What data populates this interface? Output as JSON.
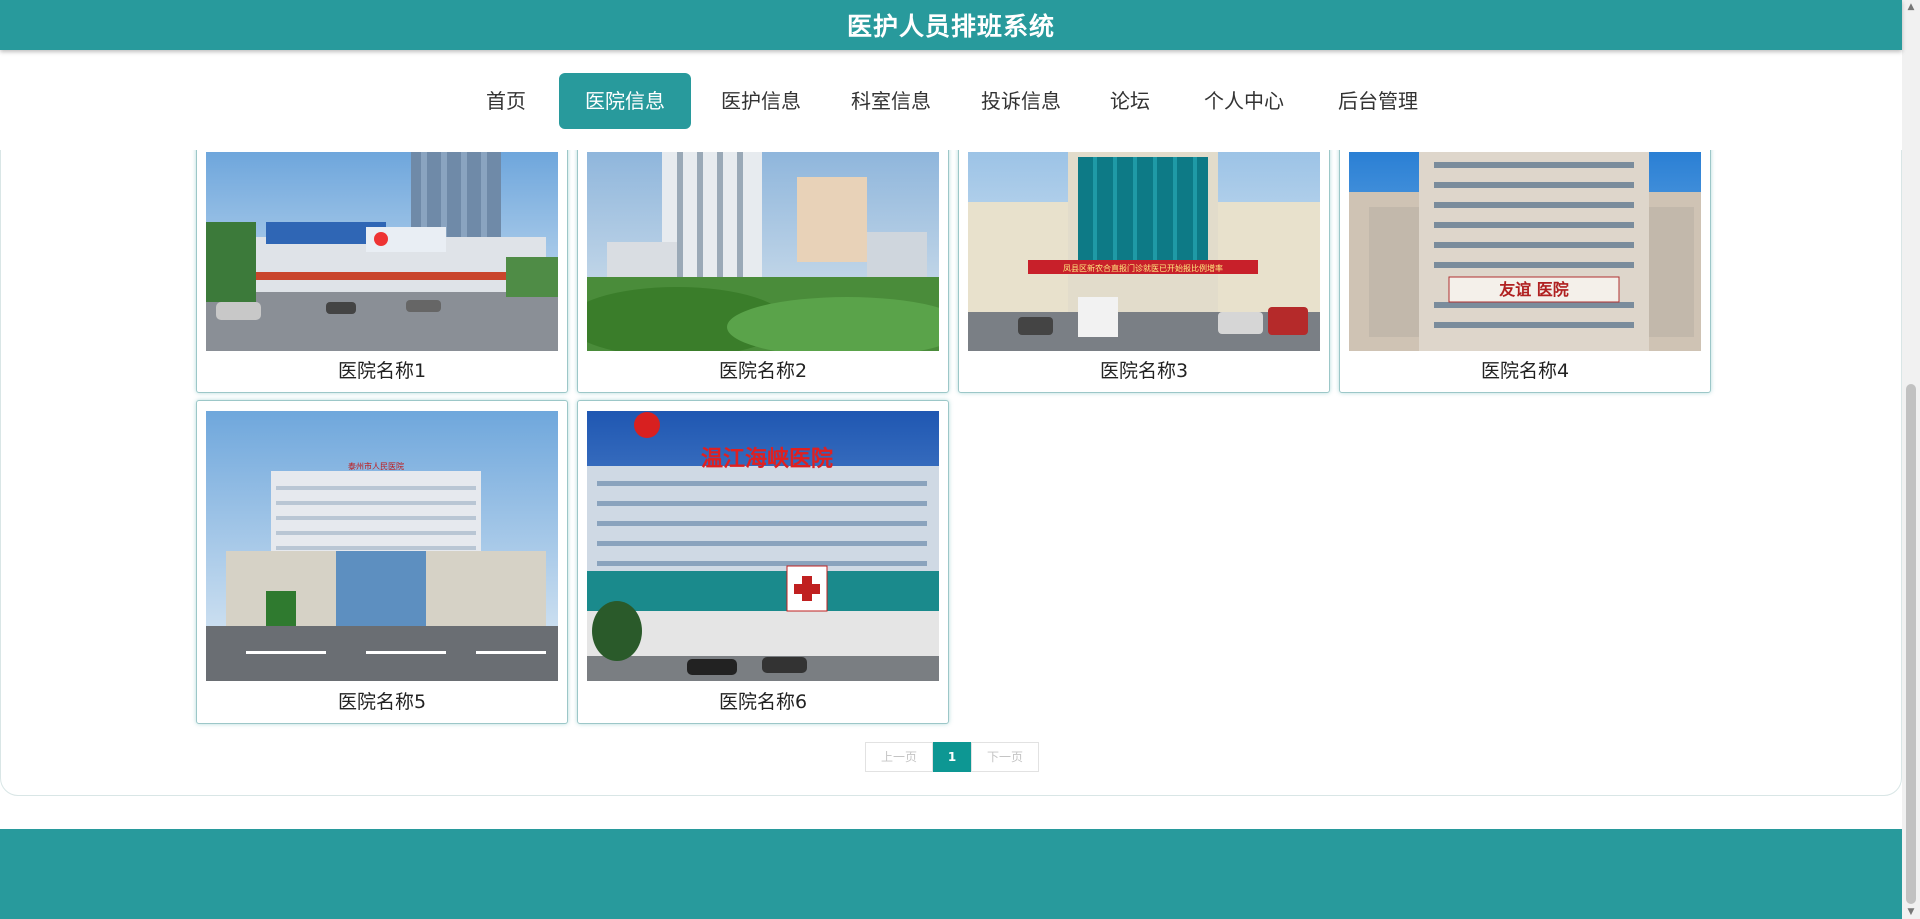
{
  "header": {
    "title": "医护人员排班系统"
  },
  "nav": {
    "items": [
      {
        "label": "首页"
      },
      {
        "label": "医院信息"
      },
      {
        "label": "医护信息"
      },
      {
        "label": "科室信息"
      },
      {
        "label": "投诉信息"
      },
      {
        "label": "论坛"
      },
      {
        "label": "个人中心"
      },
      {
        "label": "后台管理"
      }
    ],
    "active": "医院信息"
  },
  "hospitals": [
    {
      "name": "医院名称1"
    },
    {
      "name": "医院名称2"
    },
    {
      "name": "医院名称3",
      "banner": "凤县区新农合直报门诊就医已开始报比例增率"
    },
    {
      "name": "医院名称4",
      "sign": "友谊 医院"
    },
    {
      "name": "医院名称5",
      "sign": "泰州市人民医院"
    },
    {
      "name": "医院名称6",
      "sign": "温江海峡医院"
    }
  ],
  "pagination": {
    "prev": "上一页",
    "current": "1",
    "next": "下一页"
  },
  "colors": {
    "primary": "#289a9c",
    "pager_active": "#0d9793"
  }
}
